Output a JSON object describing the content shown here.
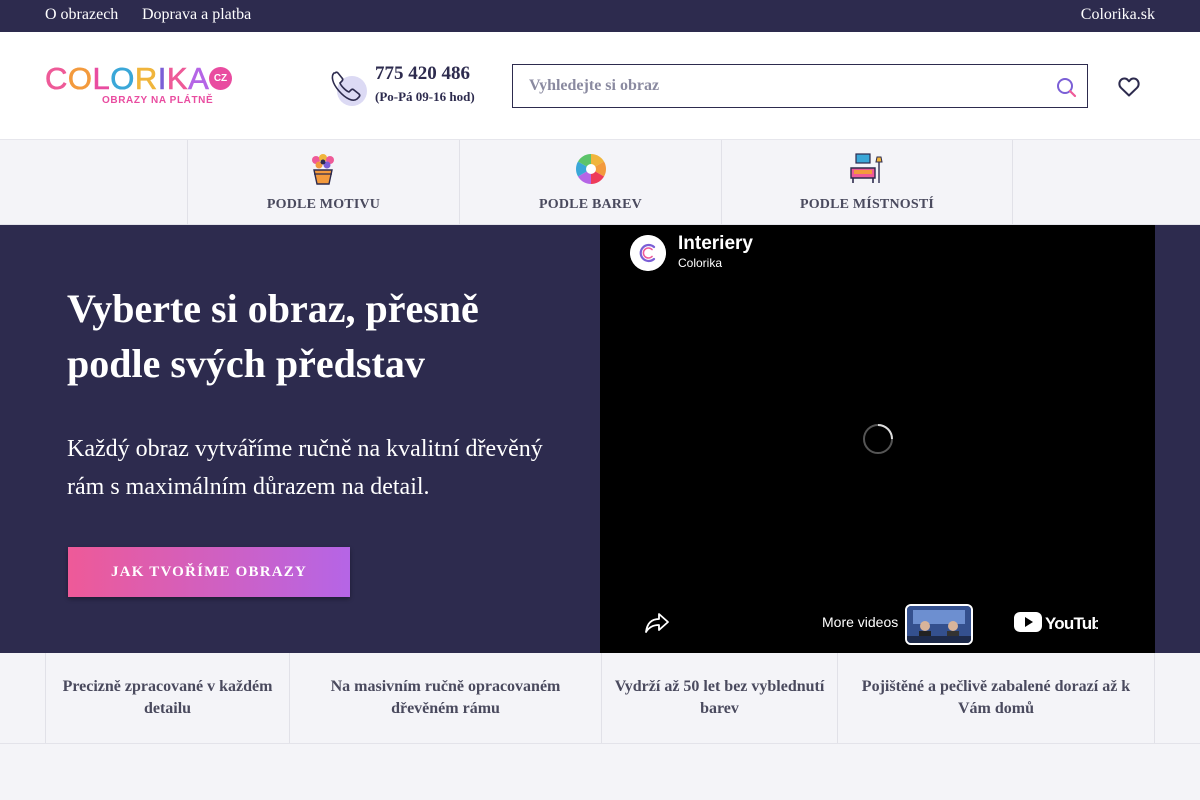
{
  "topbar": {
    "link_about": "O obrazech",
    "link_shipping": "Doprava a platba",
    "link_sk": "Colorika.sk"
  },
  "logo": {
    "wordmark": "COLORIKA",
    "badge": "CZ",
    "tagline": "OBRAZY NA PLÁTNĚ",
    "letter_colors": [
      "#ee5a98",
      "#f39a3d",
      "#e94ca0",
      "#3aa7d8",
      "#f0b53c",
      "#7b5fd6",
      "#ee5a98",
      "#b565e6"
    ]
  },
  "contact": {
    "phone": "775 420 486",
    "hours": "(Po-Pá 09-16 hod)",
    "icon": "phone-icon"
  },
  "search": {
    "placeholder": "Vyhledejte si obraz",
    "value": "",
    "icon": "search-icon"
  },
  "wishlist": {
    "icon": "heart-icon"
  },
  "categories": [
    {
      "label": "PODLE MOTIVU",
      "icon": "flower-pot-icon"
    },
    {
      "label": "PODLE BAREV",
      "icon": "color-wheel-icon"
    },
    {
      "label": "PODLE MÍSTNOSTÍ",
      "icon": "sofa-icon"
    }
  ],
  "hero": {
    "heading": "Vyberte si obraz, přesně podle svých představ",
    "text": "Každý obraz vytváříme ručně na kvalitní dřevěný rám s maximálním důrazem na detail.",
    "cta": "JAK TVOŘÍME OBRAZY"
  },
  "video": {
    "title": "Interiery",
    "channel": "Colorika",
    "more_videos": "More videos",
    "brand": "YouTube"
  },
  "features": [
    "Precizně zpracované v každém detailu",
    "Na masivním ručně opracovaném dřevěném rámu",
    "Vydrží až 50 let bez vyblednutí barev",
    "Pojištěné a pečlivě zabalené dorazí až k Vám domů"
  ],
  "colors": {
    "navy": "#2d2b4e",
    "pink": "#ee5a98",
    "purple": "#b565e6",
    "panel": "#f4f4f8"
  }
}
